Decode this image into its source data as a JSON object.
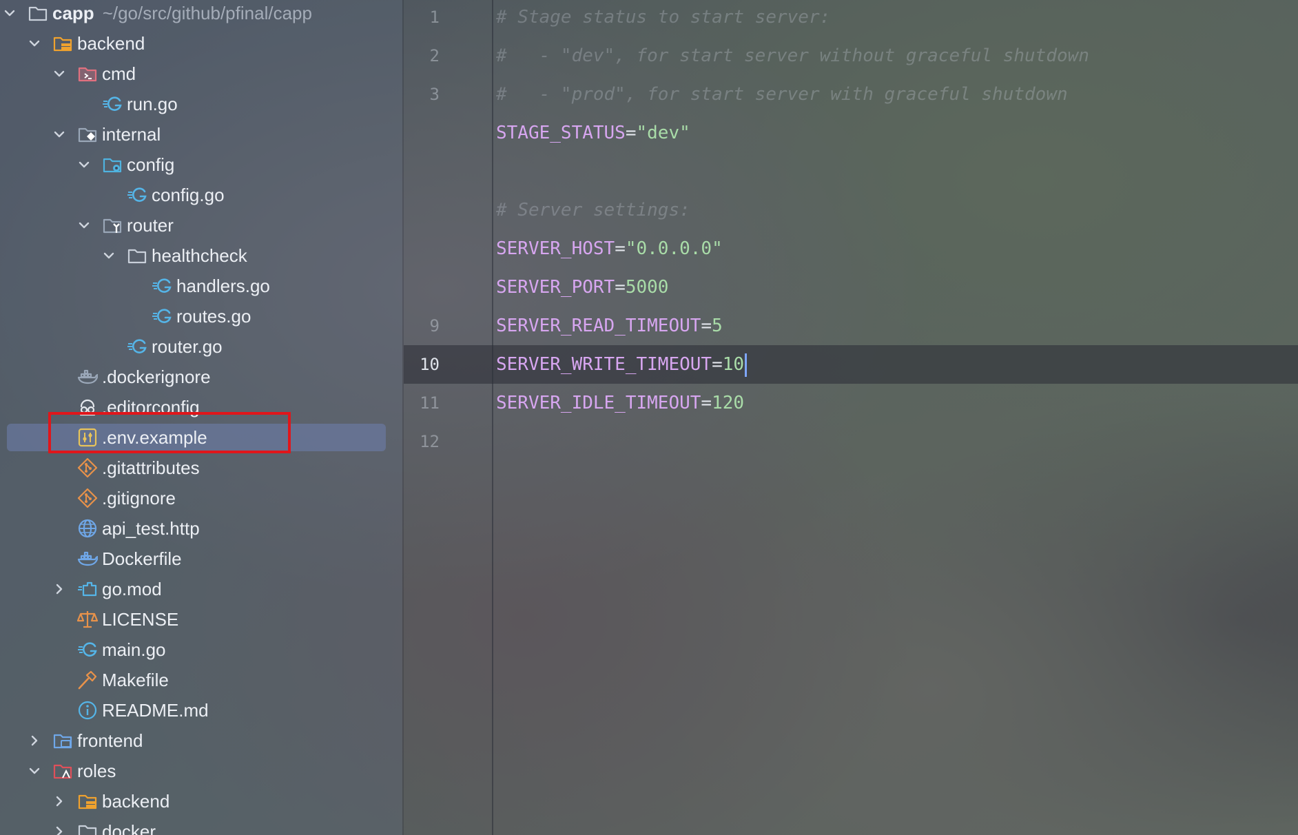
{
  "project_tree": {
    "root": {
      "name": "capp",
      "path": "~/go/src/github/pfinal/capp"
    },
    "items": [
      {
        "label": "backend",
        "depth": 1,
        "chevron": "expanded",
        "icon": "backend-folder-icon",
        "icon_color": "#f0a22e"
      },
      {
        "label": "cmd",
        "depth": 2,
        "chevron": "expanded",
        "icon": "cmd-folder-icon",
        "icon_color": "#e0707f"
      },
      {
        "label": "run.go",
        "depth": 3,
        "chevron": "none",
        "icon": "go-file-icon",
        "icon_color": "#55b5e8"
      },
      {
        "label": "internal",
        "depth": 2,
        "chevron": "expanded",
        "icon": "internal-folder-icon",
        "icon_color": "#9aa7b8"
      },
      {
        "label": "config",
        "depth": 3,
        "chevron": "expanded",
        "icon": "config-folder-icon",
        "icon_color": "#4fb3e0"
      },
      {
        "label": "config.go",
        "depth": 4,
        "chevron": "none",
        "icon": "go-file-icon",
        "icon_color": "#55b5e8"
      },
      {
        "label": "router",
        "depth": 3,
        "chevron": "expanded",
        "icon": "router-folder-icon",
        "icon_color": "#9aa7b8"
      },
      {
        "label": "healthcheck",
        "depth": 4,
        "chevron": "expanded",
        "icon": "folder-icon",
        "icon_color": "#c9d0da"
      },
      {
        "label": "handlers.go",
        "depth": 5,
        "chevron": "none",
        "icon": "go-file-icon",
        "icon_color": "#55b5e8"
      },
      {
        "label": "routes.go",
        "depth": 5,
        "chevron": "none",
        "icon": "go-file-icon",
        "icon_color": "#55b5e8"
      },
      {
        "label": "router.go",
        "depth": 4,
        "chevron": "none",
        "icon": "go-file-icon",
        "icon_color": "#55b5e8"
      },
      {
        "label": ".dockerignore",
        "depth": 2,
        "chevron": "none",
        "icon": "docker-icon",
        "icon_color": "#9aa7b8"
      },
      {
        "label": ".editorconfig",
        "depth": 2,
        "chevron": "none",
        "icon": "editorconfig-icon",
        "icon_color": "#e6e9ee"
      },
      {
        "label": ".env.example",
        "depth": 2,
        "chevron": "none",
        "icon": "env-file-icon",
        "icon_color": "#e8c45a",
        "selected": true
      },
      {
        "label": ".gitattributes",
        "depth": 2,
        "chevron": "none",
        "icon": "git-icon",
        "icon_color": "#e8924a"
      },
      {
        "label": ".gitignore",
        "depth": 2,
        "chevron": "none",
        "icon": "git-icon",
        "icon_color": "#e8924a"
      },
      {
        "label": "api_test.http",
        "depth": 2,
        "chevron": "none",
        "icon": "http-globe-icon",
        "icon_color": "#6fa7e8"
      },
      {
        "label": "Dockerfile",
        "depth": 2,
        "chevron": "none",
        "icon": "docker-icon",
        "icon_color": "#6fa7e8"
      },
      {
        "label": "go.mod",
        "depth": 2,
        "chevron": "collapsed",
        "icon": "go-mod-icon",
        "icon_color": "#55b5e8"
      },
      {
        "label": "LICENSE",
        "depth": 2,
        "chevron": "none",
        "icon": "license-scales-icon",
        "icon_color": "#e8924a"
      },
      {
        "label": "main.go",
        "depth": 2,
        "chevron": "none",
        "icon": "go-file-icon",
        "icon_color": "#55b5e8"
      },
      {
        "label": "Makefile",
        "depth": 2,
        "chevron": "none",
        "icon": "makefile-hammer-icon",
        "icon_color": "#e8924a"
      },
      {
        "label": "README.md",
        "depth": 2,
        "chevron": "none",
        "icon": "info-icon",
        "icon_color": "#55b5e8"
      },
      {
        "label": "frontend",
        "depth": 1,
        "chevron": "collapsed",
        "icon": "frontend-folder-icon",
        "icon_color": "#6fa7e8"
      },
      {
        "label": "roles",
        "depth": 1,
        "chevron": "expanded",
        "icon": "roles-folder-icon",
        "icon_color": "#e0505a"
      },
      {
        "label": "backend",
        "depth": 2,
        "chevron": "collapsed",
        "icon": "backend-folder-icon",
        "icon_color": "#f0a22e"
      },
      {
        "label": "docker",
        "depth": 2,
        "chevron": "collapsed",
        "icon": "folder-icon",
        "icon_color": "#c9d0da"
      }
    ]
  },
  "editor": {
    "current_line": 10,
    "lines": [
      {
        "num": "1",
        "tokens": [
          {
            "t": "# Stage status to start server:",
            "k": "comment"
          }
        ]
      },
      {
        "num": "2",
        "tokens": [
          {
            "t": "#   - \"dev\", for start server without graceful shutdown",
            "k": "comment"
          }
        ]
      },
      {
        "num": "3",
        "tokens": [
          {
            "t": "#   - \"prod\", for start server with graceful shutdown",
            "k": "comment"
          }
        ]
      },
      {
        "num": "",
        "tokens": [
          {
            "t": "STAGE_STATUS",
            "k": "key"
          },
          {
            "t": "=",
            "k": "op"
          },
          {
            "t": "\"dev\"",
            "k": "str"
          }
        ]
      },
      {
        "num": "",
        "tokens": []
      },
      {
        "num": "",
        "tokens": [
          {
            "t": "# Server settings:",
            "k": "comment"
          }
        ]
      },
      {
        "num": "",
        "tokens": [
          {
            "t": "SERVER_HOST",
            "k": "key"
          },
          {
            "t": "=",
            "k": "op"
          },
          {
            "t": "\"0.0.0.0\"",
            "k": "str"
          }
        ]
      },
      {
        "num": "",
        "tokens": [
          {
            "t": "SERVER_PORT",
            "k": "key"
          },
          {
            "t": "=",
            "k": "op"
          },
          {
            "t": "5000",
            "k": "num"
          }
        ]
      },
      {
        "num": "9",
        "tokens": [
          {
            "t": "SERVER_READ_TIMEOUT",
            "k": "key"
          },
          {
            "t": "=",
            "k": "op"
          },
          {
            "t": "5",
            "k": "num"
          }
        ]
      },
      {
        "num": "10",
        "tokens": [
          {
            "t": "SERVER_WRITE_TIMEOUT",
            "k": "key"
          },
          {
            "t": "=",
            "k": "op"
          },
          {
            "t": "10",
            "k": "num"
          }
        ],
        "caret": true
      },
      {
        "num": "11",
        "tokens": [
          {
            "t": "SERVER_IDLE_TIMEOUT",
            "k": "key"
          },
          {
            "t": "=",
            "k": "op"
          },
          {
            "t": "120",
            "k": "num"
          }
        ]
      },
      {
        "num": "12",
        "tokens": []
      }
    ]
  },
  "colors": {
    "highlight_box": "#e0161b",
    "selection": "#6c7da8",
    "key": "#d7a6f0",
    "string": "#a9dca8"
  }
}
